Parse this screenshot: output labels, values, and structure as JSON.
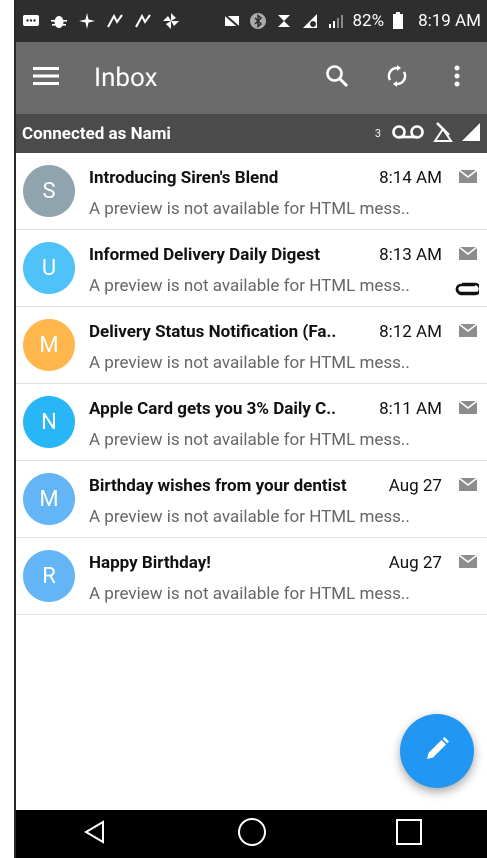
{
  "status_bar": {
    "battery": "82%",
    "time": "8:19 AM"
  },
  "app_bar": {
    "title": "Inbox",
    "icons": [
      "menu-icon",
      "search-icon",
      "sync-icon",
      "more-vert-icon"
    ]
  },
  "connection_bar": {
    "text": "Connected as Nami",
    "voicemail_count": "3"
  },
  "emails": [
    {
      "avatar_letter": "S",
      "avatar_color": "#90a4ae",
      "subject": "Introducing Siren's Blend",
      "time": "8:14 AM",
      "preview": "A preview is not available for HTML mess..",
      "attachment": false
    },
    {
      "avatar_letter": "U",
      "avatar_color": "#4fc3f7",
      "subject": "Informed Delivery Daily Digest",
      "time": "8:13 AM",
      "preview": "A preview is not available for HTML mess..",
      "attachment": true
    },
    {
      "avatar_letter": "M",
      "avatar_color": "#ffb74d",
      "subject": "Delivery Status Notification (Fa..",
      "time": "8:12 AM",
      "preview": "A preview is not available for HTML mess..",
      "attachment": false
    },
    {
      "avatar_letter": "N",
      "avatar_color": "#29b6f6",
      "subject": "Apple Card gets you 3% Daily C..",
      "time": "8:11 AM",
      "preview": "A preview is not available for HTML mess..",
      "attachment": false
    },
    {
      "avatar_letter": "M",
      "avatar_color": "#64b5f6",
      "subject": "Birthday wishes from your dentist",
      "time": "Aug 27",
      "preview": "A preview is not available for HTML mess..",
      "attachment": false
    },
    {
      "avatar_letter": "R",
      "avatar_color": "#64b5f6",
      "subject": "Happy Birthday!",
      "time": "Aug 27",
      "preview": "A preview is not available for HTML mess..",
      "attachment": false
    }
  ],
  "fab": {
    "icon": "pencil-icon",
    "color": "#2196f3"
  },
  "nav_bar": {
    "icons": [
      "back-icon",
      "home-icon",
      "recents-icon"
    ]
  },
  "colors": {
    "status_bar": "#2e2e2e",
    "app_bar": "#6b6b6b",
    "connection_bar": "#4b4b4b",
    "nav_bar": "#000000"
  }
}
